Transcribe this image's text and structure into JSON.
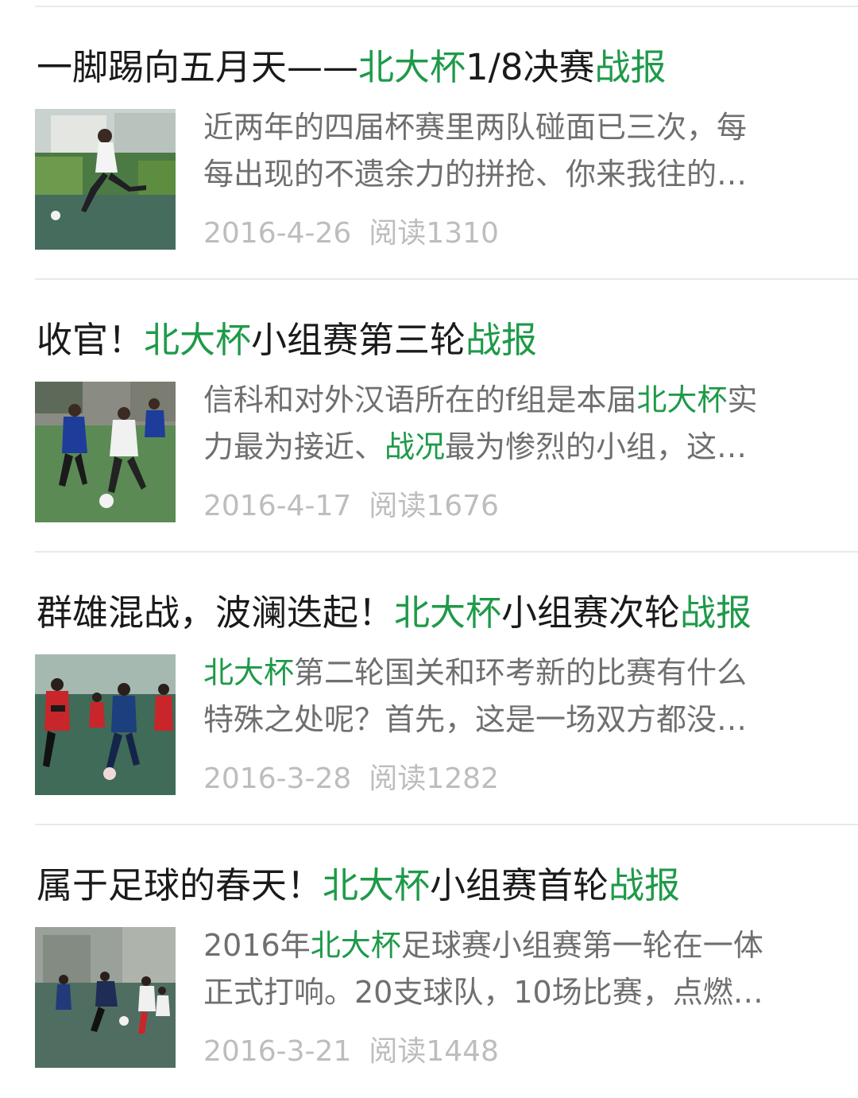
{
  "articles": [
    {
      "title": [
        {
          "text": "一脚踢向五月天——",
          "hl": false
        },
        {
          "text": "北大杯",
          "hl": true
        },
        {
          "text": "1/8决赛",
          "hl": false
        },
        {
          "text": "战报",
          "hl": true
        }
      ],
      "summary_lines": [
        [
          {
            "text": "近两年的四届杯赛里两队碰面已三次，每",
            "hl": false
          }
        ],
        [
          {
            "text": "每出现的不遗余力的拼抢、你来我往的…",
            "hl": false
          }
        ]
      ],
      "date": "2016-4-26",
      "reads": "阅读1310"
    },
    {
      "title": [
        {
          "text": "收官！",
          "hl": false
        },
        {
          "text": "北大杯",
          "hl": true
        },
        {
          "text": "小组赛第三轮",
          "hl": false
        },
        {
          "text": "战报",
          "hl": true
        }
      ],
      "summary_lines": [
        [
          {
            "text": "信科和对外汉语所在的f组是本届",
            "hl": false
          },
          {
            "text": "北大杯",
            "hl": true
          },
          {
            "text": "实",
            "hl": false
          }
        ],
        [
          {
            "text": "力最为接近、",
            "hl": false
          },
          {
            "text": "战况",
            "hl": true
          },
          {
            "text": "最为惨烈的小组，这…",
            "hl": false
          }
        ]
      ],
      "date": "2016-4-17",
      "reads": "阅读1676"
    },
    {
      "title": [
        {
          "text": "群雄混战，波澜迭起！",
          "hl": false
        },
        {
          "text": "北大杯",
          "hl": true
        },
        {
          "text": "小组赛次轮",
          "hl": false
        },
        {
          "text": "战报",
          "hl": true
        }
      ],
      "summary_lines": [
        [
          {
            "text": "北大杯",
            "hl": true
          },
          {
            "text": "第二轮国关和环考新的比赛有什么",
            "hl": false
          }
        ],
        [
          {
            "text": "特殊之处呢？首先，这是一场双方都没…",
            "hl": false
          }
        ]
      ],
      "date": "2016-3-28",
      "reads": "阅读1282"
    },
    {
      "title": [
        {
          "text": "属于足球的春天！",
          "hl": false
        },
        {
          "text": "北大杯",
          "hl": true
        },
        {
          "text": "小组赛首轮",
          "hl": false
        },
        {
          "text": "战报",
          "hl": true
        }
      ],
      "summary_lines": [
        [
          {
            "text": "2016年",
            "hl": false
          },
          {
            "text": "北大杯",
            "hl": true
          },
          {
            "text": "足球赛小组赛第一轮在一体",
            "hl": false
          }
        ],
        [
          {
            "text": "正式打响。20支球队，10场比赛，点燃…",
            "hl": false
          }
        ]
      ],
      "date": "2016-3-21",
      "reads": "阅读1448"
    }
  ],
  "colors": {
    "highlight": "#1e9a49",
    "title": "#1a1a1a",
    "summary": "#6f6f6f",
    "meta": "#bdbdbd",
    "divider": "#e9e9e9"
  }
}
